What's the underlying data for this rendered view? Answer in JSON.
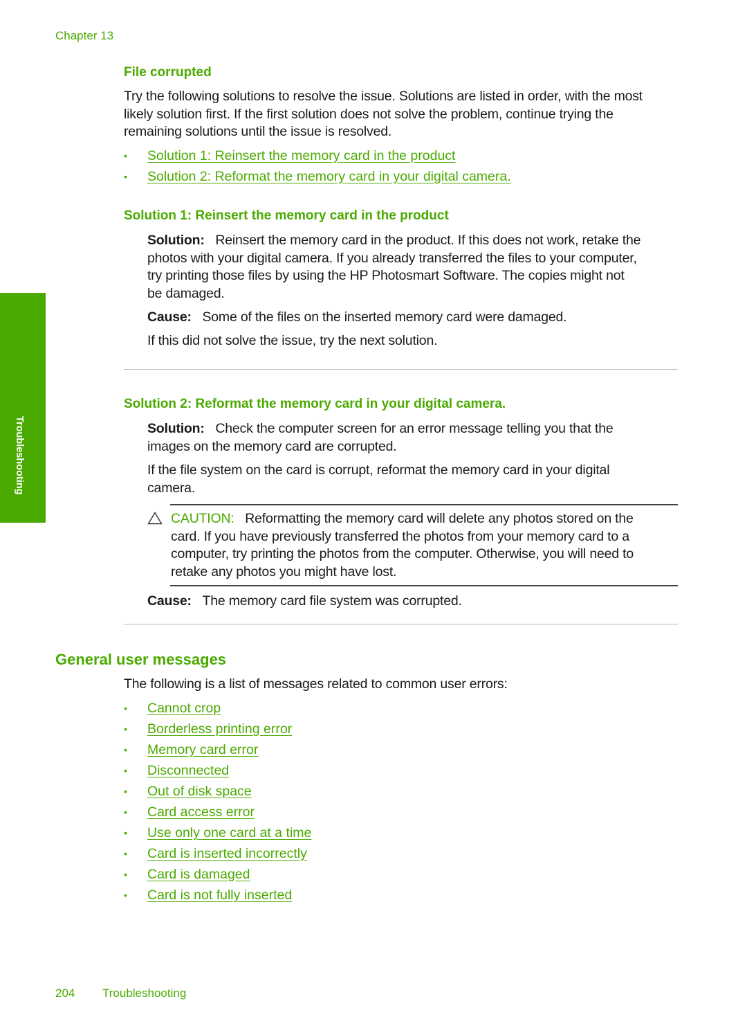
{
  "header": {
    "chapter": "Chapter 13"
  },
  "side_tab": {
    "label": "Troubleshooting"
  },
  "file_corrupted": {
    "heading": "File corrupted",
    "intro_lines": [
      "Try the following solutions to resolve the issue. Solutions are listed in order, with the most",
      "likely solution first. If the first solution does not solve the problem, continue trying the",
      "remaining solutions until the issue is resolved."
    ],
    "links": [
      "Solution 1: Reinsert the memory card in the product",
      "Solution 2: Reformat the memory card in your digital camera."
    ]
  },
  "solution1": {
    "heading": "Solution 1: Reinsert the memory card in the product",
    "solution_label": "Solution:",
    "solution_lines": [
      "Reinsert the memory card in the product. If this does not work, retake the",
      "photos with your digital camera. If you already transferred the files to your computer,",
      "try printing those files by using the HP Photosmart Software. The copies might not",
      "be damaged."
    ],
    "cause_label": "Cause:",
    "cause_text": "Some of the files on the inserted memory card were damaged.",
    "next_text": "If this did not solve the issue, try the next solution."
  },
  "solution2": {
    "heading": "Solution 2: Reformat the memory card in your digital camera.",
    "solution_label": "Solution:",
    "solution_lines": [
      "Check the computer screen for an error message telling you that the",
      "images on the memory card are corrupted."
    ],
    "para_lines": [
      "If the file system on the card is corrupt, reformat the memory card in your digital",
      "camera."
    ],
    "caution": {
      "icon": "warning-triangle-icon",
      "label": "CAUTION:",
      "lines": [
        "Reformatting the memory card will delete any photos stored on the",
        "card. If you have previously transferred the photos from your memory card to a",
        "computer, try printing the photos from the computer. Otherwise, you will need to",
        "retake any photos you might have lost."
      ]
    },
    "cause_label": "Cause:",
    "cause_text": "The memory card file system was corrupted."
  },
  "general": {
    "heading": "General user messages",
    "intro": "The following is a list of messages related to common user errors:",
    "links": [
      "Cannot crop",
      "Borderless printing error",
      "Memory card error",
      "Disconnected",
      "Out of disk space",
      "Card access error",
      "Use only one card at a time",
      "Card is inserted incorrectly",
      "Card is damaged",
      "Card is not fully inserted"
    ]
  },
  "footer": {
    "page_number": "204",
    "section": "Troubleshooting"
  },
  "colors": {
    "accent": "#4aaa00",
    "text": "#1a1a1a",
    "rule": "#b8b8b8"
  }
}
